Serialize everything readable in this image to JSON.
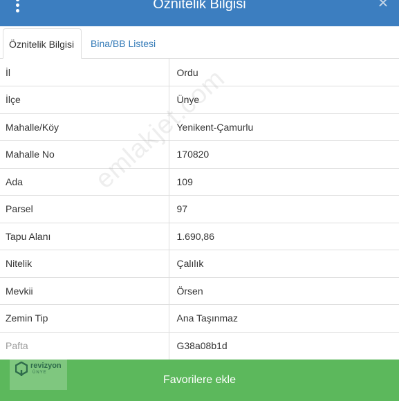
{
  "header": {
    "title": "Öznitelik Bilgisi",
    "close_glyph": "✕",
    "menu_icon": "vertical-dots-icon"
  },
  "tabs": [
    {
      "label": "Öznitelik Bilgisi",
      "active": true
    },
    {
      "label": "Bina/BB Listesi",
      "active": false
    }
  ],
  "attributes": [
    {
      "key": "İl",
      "value": "Ordu"
    },
    {
      "key": "İlçe",
      "value": "Ünye"
    },
    {
      "key": "Mahalle/Köy",
      "value": "Yenikent-Çamurlu"
    },
    {
      "key": "Mahalle No",
      "value": "170820"
    },
    {
      "key": "Ada",
      "value": "109"
    },
    {
      "key": "Parsel",
      "value": "97"
    },
    {
      "key": "Tapu Alanı",
      "value": "1.690,86"
    },
    {
      "key": "Nitelik",
      "value": "Çalılık"
    },
    {
      "key": "Mevkii",
      "value": "Örsen"
    },
    {
      "key": "Zemin Tip",
      "value": "Ana Taşınmaz"
    },
    {
      "key": "Pafta",
      "value": "G38a08b1d"
    }
  ],
  "watermark": "emlakjet.com",
  "logo": {
    "name": "revizyon",
    "sub": "ÜNYE"
  },
  "footer": {
    "button_label": "Favorilere ekle"
  },
  "colors": {
    "header_bg": "#3c7ec0",
    "button_bg": "#5cb85c",
    "link": "#337ab7"
  }
}
